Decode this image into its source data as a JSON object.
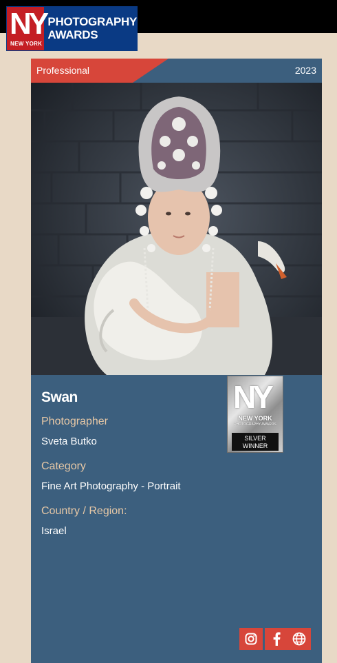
{
  "brand": {
    "ny": "NY",
    "ny_sub": "NEW YORK",
    "line1": "PHOTOGRAPHY",
    "line2": "AWARDS",
    "colors": {
      "red": "#c41e24",
      "blue": "#0a3a84"
    }
  },
  "card": {
    "tier": "Professional",
    "year": "2023",
    "title": "Swan",
    "photographer_label": "Photographer",
    "photographer": "Sveta Butko",
    "category_label": "Category",
    "category": "Fine Art Photography - Portrait",
    "country_label": "Country / Region:",
    "country": "Israel",
    "colors": {
      "panel": "#3c5f7e",
      "accent": "#d7463a",
      "label": "#e7c8a6"
    }
  },
  "badge": {
    "ny": "NY",
    "name": "NEW YORK",
    "sub": "PHOTOGRAPHY AWARDS",
    "award_line1": "SILVER",
    "award_line2": "WINNER"
  },
  "social": [
    {
      "icon": "instagram-icon"
    },
    {
      "icon": "facebook-icon"
    },
    {
      "icon": "globe-icon"
    }
  ]
}
